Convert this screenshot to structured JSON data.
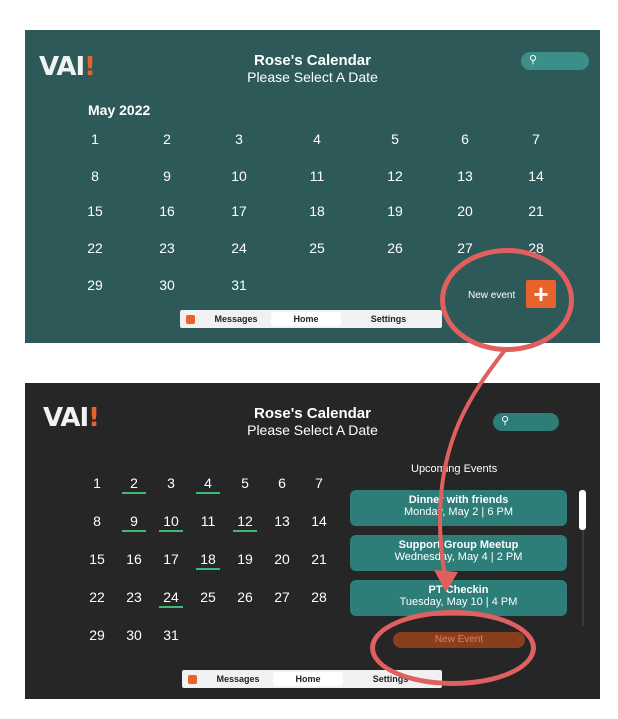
{
  "top": {
    "logo": "VAI!",
    "title": "Rose's Calendar",
    "subtitle": "Please Select A Date",
    "month": "May 2022",
    "weeks": [
      [
        "1",
        "2",
        "3",
        "4",
        "5",
        "6",
        "7"
      ],
      [
        "8",
        "9",
        "10",
        "11",
        "12",
        "13",
        "14"
      ],
      [
        "15",
        "16",
        "17",
        "18",
        "19",
        "20",
        "21"
      ],
      [
        "22",
        "23",
        "24",
        "25",
        "26",
        "27",
        "28"
      ],
      [
        "29",
        "30",
        "31"
      ]
    ],
    "new_event_label": "New event",
    "plus": "+",
    "nav": {
      "messages": "Messages",
      "home": "Home",
      "settings": "Settings"
    }
  },
  "bottom": {
    "logo": "VAI!",
    "title": "Rose's Calendar",
    "subtitle": "Please Select A Date",
    "weeks": [
      [
        "1",
        "2",
        "3",
        "4",
        "5",
        "6",
        "7"
      ],
      [
        "8",
        "9",
        "10",
        "11",
        "12",
        "13",
        "14"
      ],
      [
        "15",
        "16",
        "17",
        "18",
        "19",
        "20",
        "21"
      ],
      [
        "22",
        "23",
        "24",
        "25",
        "26",
        "27",
        "28"
      ],
      [
        "29",
        "30",
        "31"
      ]
    ],
    "underlined_days": [
      "2",
      "4",
      "9",
      "10",
      "12",
      "18",
      "24"
    ],
    "upcoming_title": "Upcoming Events",
    "events": [
      {
        "name": "Dinner with friends",
        "date": "Monday, May 2 |  6 PM"
      },
      {
        "name": "Support Group Meetup",
        "date": "Wednesday, May 4 |  2 PM"
      },
      {
        "name": "PT Checkin",
        "date": "Tuesday, May 10 |  4 PM"
      }
    ],
    "new_event_button": "New Event",
    "nav": {
      "messages": "Messages",
      "home": "Home",
      "settings": "Settings"
    }
  },
  "colors": {
    "teal_panel": "#2d5a59",
    "dark_panel": "#262626",
    "accent": "#e8622c",
    "card": "#2d7d78",
    "underline": "#3cb878",
    "annotation": "#e06060"
  }
}
